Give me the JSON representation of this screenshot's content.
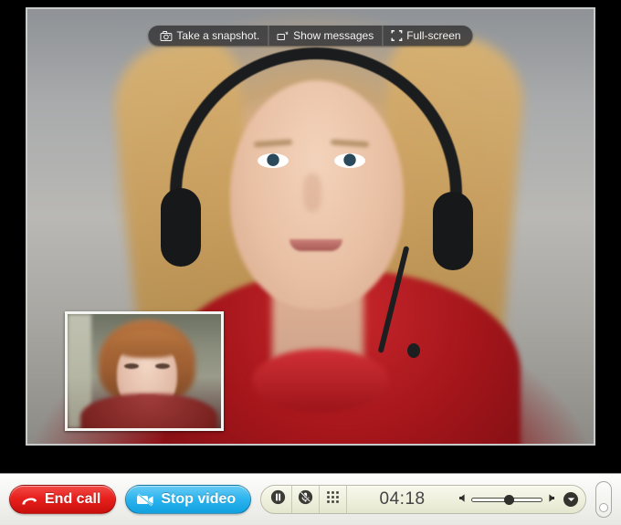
{
  "window": {
    "title": "Video call",
    "stage_background": "#000000",
    "video_border_color": "#c9cbcb"
  },
  "video_overlay_bar": {
    "buttons": [
      {
        "id": "snapshot",
        "label": "Take a snapshot.",
        "icon": "camera-icon"
      },
      {
        "id": "show-messages",
        "label": "Show messages",
        "icon": "speech-bubble-icon"
      },
      {
        "id": "full-screen",
        "label": "Full-screen",
        "icon": "expand-corners-icon"
      }
    ]
  },
  "pip": {
    "label": "Self view",
    "border_color": "#f4f4f2"
  },
  "toolbar": {
    "end_call": {
      "label": "End call",
      "icon": "hangup-phone-icon",
      "color": "#e8201c"
    },
    "stop_video": {
      "label": "Stop video",
      "icon": "camera-off-icon",
      "color": "#2cb4ef"
    },
    "console": {
      "icons": [
        {
          "id": "pause",
          "name": "pause-icon",
          "title": "Hold call"
        },
        {
          "id": "mute",
          "name": "mic-mute-icon",
          "title": "Mute microphone"
        },
        {
          "id": "keypad",
          "name": "dialpad-icon",
          "title": "Dial pad"
        }
      ],
      "timer": "04:18",
      "volume": {
        "min_icon": "speaker-low-icon",
        "max_icon": "speaker-high-icon",
        "level": 46,
        "dropdown_icon": "chevron-down-icon"
      }
    },
    "side_handle": {
      "name": "resize-handle"
    }
  }
}
